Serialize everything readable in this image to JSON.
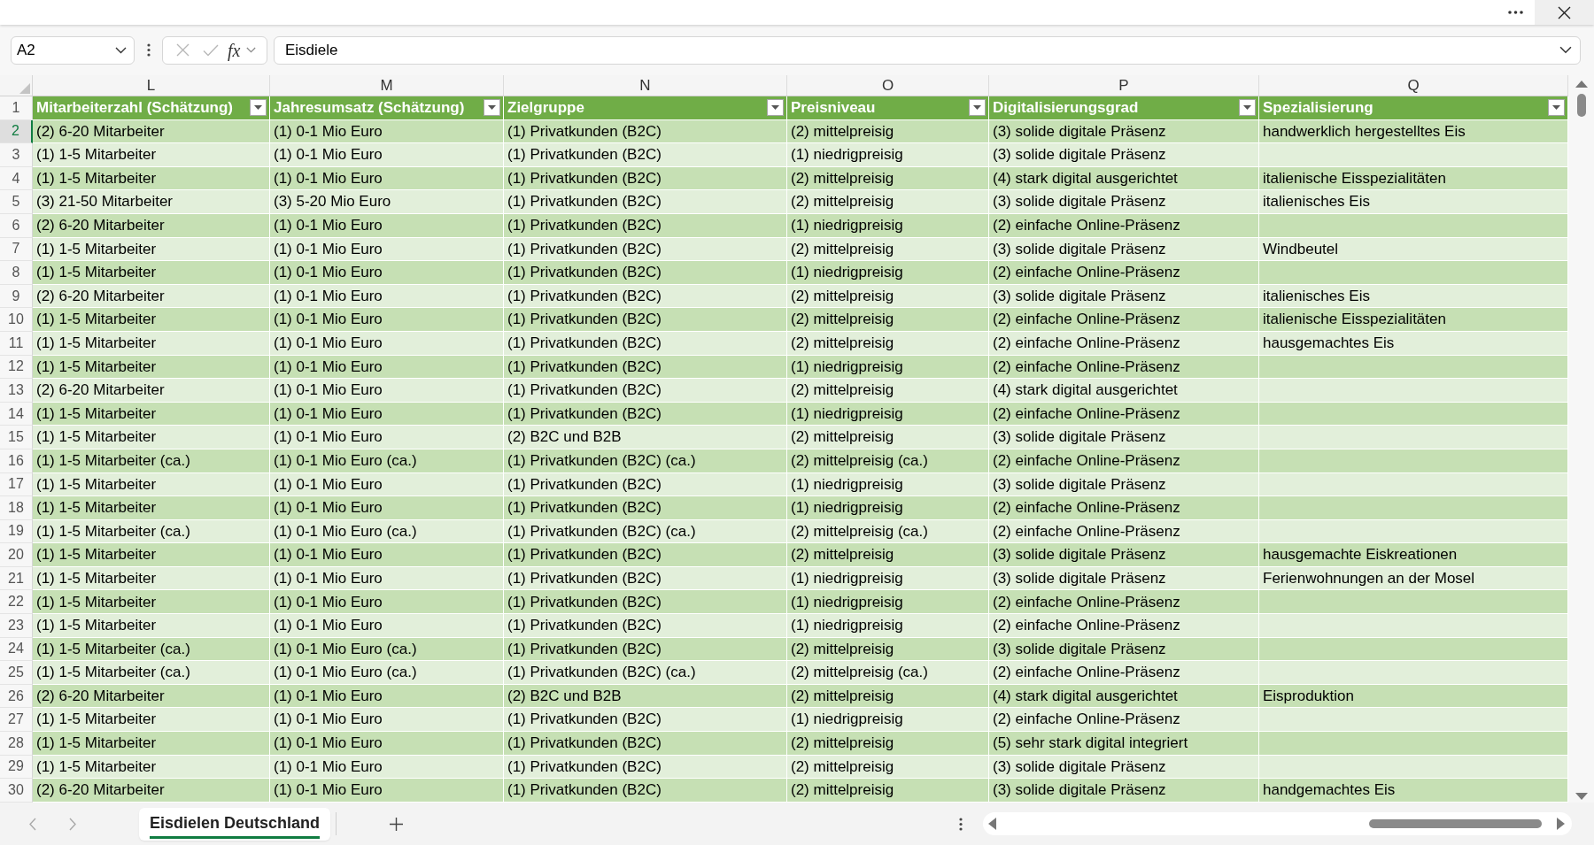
{
  "name_box": {
    "value": "A2"
  },
  "formula_bar": {
    "cancel": {
      "disabled": true
    },
    "enter": {
      "disabled": true
    },
    "insert_function": "fx",
    "value": "Eisdiele"
  },
  "column_letters": [
    {
      "label": "L",
      "selected": false
    },
    {
      "label": "M",
      "selected": false
    },
    {
      "label": "N",
      "selected": false
    },
    {
      "label": "O",
      "selected": false
    },
    {
      "label": "P",
      "selected": false
    },
    {
      "label": "Q",
      "selected": false
    }
  ],
  "table": {
    "header_row": {
      "number": "1",
      "selected": false,
      "columns": [
        "Mitarbeiterzahl (Schätzung)",
        "Jahresumsatz (Schätzung)",
        "Zielgruppe",
        "Preisniveau",
        "Digitalisierungsgrad",
        "Spezialisierung"
      ]
    },
    "rows": [
      {
        "number": "2",
        "selected": true,
        "cells": [
          "(2) 6-20 Mitarbeiter",
          "(1) 0-1 Mio Euro",
          "(1) Privatkunden (B2C)",
          "(2) mittelpreisig",
          "(3) solide digitale Präsenz",
          "handwerklich hergestelltes Eis"
        ]
      },
      {
        "number": "3",
        "selected": false,
        "cells": [
          "(1) 1-5 Mitarbeiter",
          "(1) 0-1 Mio Euro",
          "(1) Privatkunden (B2C)",
          "(1) niedrigpreisig",
          "(3) solide digitale Präsenz"
        ]
      },
      {
        "number": "4",
        "selected": false,
        "cells": [
          "(1) 1-5 Mitarbeiter",
          "(1) 0-1 Mio Euro",
          "(1) Privatkunden (B2C)",
          "(2) mittelpreisig",
          "(4) stark digital ausgerichtet",
          "italienische Eisspezialitäten"
        ]
      },
      {
        "number": "5",
        "selected": false,
        "cells": [
          "(3) 21-50 Mitarbeiter",
          "(3) 5-20 Mio Euro",
          "(1) Privatkunden (B2C)",
          "(2) mittelpreisig",
          "(3) solide digitale Präsenz",
          "italienisches Eis"
        ]
      },
      {
        "number": "6",
        "selected": false,
        "cells": [
          "(2) 6-20 Mitarbeiter",
          "(1) 0-1 Mio Euro",
          "(1) Privatkunden (B2C)",
          "(1) niedrigpreisig",
          "(2) einfache Online-Präsenz"
        ]
      },
      {
        "number": "7",
        "selected": false,
        "cells": [
          "(1) 1-5 Mitarbeiter",
          "(1) 0-1 Mio Euro",
          "(1) Privatkunden (B2C)",
          "(2) mittelpreisig",
          "(3) solide digitale Präsenz",
          "Windbeutel"
        ]
      },
      {
        "number": "8",
        "selected": false,
        "cells": [
          "(1) 1-5 Mitarbeiter",
          "(1) 0-1 Mio Euro",
          "(1) Privatkunden (B2C)",
          "(1) niedrigpreisig",
          "(2) einfache Online-Präsenz"
        ]
      },
      {
        "number": "9",
        "selected": false,
        "cells": [
          "(2) 6-20 Mitarbeiter",
          "(1) 0-1 Mio Euro",
          "(1) Privatkunden (B2C)",
          "(2) mittelpreisig",
          "(3) solide digitale Präsenz",
          "italienisches Eis"
        ]
      },
      {
        "number": "10",
        "selected": false,
        "cells": [
          "(1) 1-5 Mitarbeiter",
          "(1) 0-1 Mio Euro",
          "(1) Privatkunden (B2C)",
          "(2) mittelpreisig",
          "(2) einfache Online-Präsenz",
          "italienische Eisspezialitäten"
        ]
      },
      {
        "number": "11",
        "selected": false,
        "cells": [
          "(1) 1-5 Mitarbeiter",
          "(1) 0-1 Mio Euro",
          "(1) Privatkunden (B2C)",
          "(2) mittelpreisig",
          "(2) einfache Online-Präsenz",
          "hausgemachtes Eis"
        ]
      },
      {
        "number": "12",
        "selected": false,
        "cells": [
          "(1) 1-5 Mitarbeiter",
          "(1) 0-1 Mio Euro",
          "(1) Privatkunden (B2C)",
          "(1) niedrigpreisig",
          "(2) einfache Online-Präsenz"
        ]
      },
      {
        "number": "13",
        "selected": false,
        "cells": [
          "(2) 6-20 Mitarbeiter",
          "(1) 0-1 Mio Euro",
          "(1) Privatkunden (B2C)",
          "(2) mittelpreisig",
          "(4) stark digital ausgerichtet"
        ]
      },
      {
        "number": "14",
        "selected": false,
        "cells": [
          "(1) 1-5 Mitarbeiter",
          "(1) 0-1 Mio Euro",
          "(1) Privatkunden (B2C)",
          "(1) niedrigpreisig",
          "(2) einfache Online-Präsenz"
        ]
      },
      {
        "number": "15",
        "selected": false,
        "cells": [
          "(1) 1-5 Mitarbeiter",
          "(1) 0-1 Mio Euro",
          "(2) B2C und B2B",
          "(2) mittelpreisig",
          "(3) solide digitale Präsenz"
        ]
      },
      {
        "number": "16",
        "selected": false,
        "cells": [
          "(1) 1-5 Mitarbeiter (ca.)",
          "(1) 0-1 Mio Euro (ca.)",
          "(1) Privatkunden (B2C) (ca.)",
          "(2) mittelpreisig (ca.)",
          "(2) einfache Online-Präsenz"
        ]
      },
      {
        "number": "17",
        "selected": false,
        "cells": [
          "(1) 1-5 Mitarbeiter",
          "(1) 0-1 Mio Euro",
          "(1) Privatkunden (B2C)",
          "(1) niedrigpreisig",
          "(3) solide digitale Präsenz"
        ]
      },
      {
        "number": "18",
        "selected": false,
        "cells": [
          "(1) 1-5 Mitarbeiter",
          "(1) 0-1 Mio Euro",
          "(1) Privatkunden (B2C)",
          "(1) niedrigpreisig",
          "(2) einfache Online-Präsenz"
        ]
      },
      {
        "number": "19",
        "selected": false,
        "cells": [
          "(1) 1-5 Mitarbeiter (ca.)",
          "(1) 0-1 Mio Euro (ca.)",
          "(1) Privatkunden (B2C) (ca.)",
          "(2) mittelpreisig (ca.)",
          "(2) einfache Online-Präsenz"
        ]
      },
      {
        "number": "20",
        "selected": false,
        "cells": [
          "(1) 1-5 Mitarbeiter",
          "(1) 0-1 Mio Euro",
          "(1) Privatkunden (B2C)",
          "(2) mittelpreisig",
          "(3) solide digitale Präsenz",
          "hausgemachte Eiskreationen"
        ]
      },
      {
        "number": "21",
        "selected": false,
        "cells": [
          "(1) 1-5 Mitarbeiter",
          "(1) 0-1 Mio Euro",
          "(1) Privatkunden (B2C)",
          "(1) niedrigpreisig",
          "(3) solide digitale Präsenz",
          "Ferienwohnungen an der Mosel"
        ]
      },
      {
        "number": "22",
        "selected": false,
        "cells": [
          "(1) 1-5 Mitarbeiter",
          "(1) 0-1 Mio Euro",
          "(1) Privatkunden (B2C)",
          "(1) niedrigpreisig",
          "(2) einfache Online-Präsenz"
        ]
      },
      {
        "number": "23",
        "selected": false,
        "cells": [
          "(1) 1-5 Mitarbeiter",
          "(1) 0-1 Mio Euro",
          "(1) Privatkunden (B2C)",
          "(1) niedrigpreisig",
          "(2) einfache Online-Präsenz"
        ]
      },
      {
        "number": "24",
        "selected": false,
        "cells": [
          "(1) 1-5 Mitarbeiter (ca.)",
          "(1) 0-1 Mio Euro (ca.)",
          "(1) Privatkunden (B2C)",
          "(2) mittelpreisig",
          "(3) solide digitale Präsenz"
        ]
      },
      {
        "number": "25",
        "selected": false,
        "cells": [
          "(1) 1-5 Mitarbeiter (ca.)",
          "(1) 0-1 Mio Euro (ca.)",
          "(1) Privatkunden (B2C) (ca.)",
          "(2) mittelpreisig (ca.)",
          "(2) einfache Online-Präsenz"
        ]
      },
      {
        "number": "26",
        "selected": false,
        "cells": [
          "(2) 6-20 Mitarbeiter",
          "(1) 0-1 Mio Euro",
          "(2) B2C und B2B",
          "(2) mittelpreisig",
          "(4) stark digital ausgerichtet",
          "Eisproduktion"
        ]
      },
      {
        "number": "27",
        "selected": false,
        "cells": [
          "(1) 1-5 Mitarbeiter",
          "(1) 0-1 Mio Euro",
          "(1) Privatkunden (B2C)",
          "(1) niedrigpreisig",
          "(2) einfache Online-Präsenz"
        ]
      },
      {
        "number": "28",
        "selected": false,
        "cells": [
          "(1) 1-5 Mitarbeiter",
          "(1) 0-1 Mio Euro",
          "(1) Privatkunden (B2C)",
          "(2) mittelpreisig",
          "(5) sehr stark digital integriert"
        ]
      },
      {
        "number": "29",
        "selected": false,
        "cells": [
          "(1) 1-5 Mitarbeiter",
          "(1) 0-1 Mio Euro",
          "(1) Privatkunden (B2C)",
          "(2) mittelpreisig",
          "(3) solide digitale Präsenz"
        ]
      },
      {
        "number": "30",
        "selected": false,
        "cells": [
          "(2) 6-20 Mitarbeiter",
          "(1) 0-1 Mio Euro",
          "(1) Privatkunden (B2C)",
          "(2) mittelpreisig",
          "(3) solide digitale Präsenz",
          "handgemachtes Eis"
        ]
      }
    ]
  },
  "sheet_nav": {
    "previous": {
      "disabled": true
    },
    "next": {
      "disabled": true
    }
  },
  "sheet_tabs": [
    {
      "label": "Eisdielen Deutschland",
      "selected": true
    }
  ]
}
